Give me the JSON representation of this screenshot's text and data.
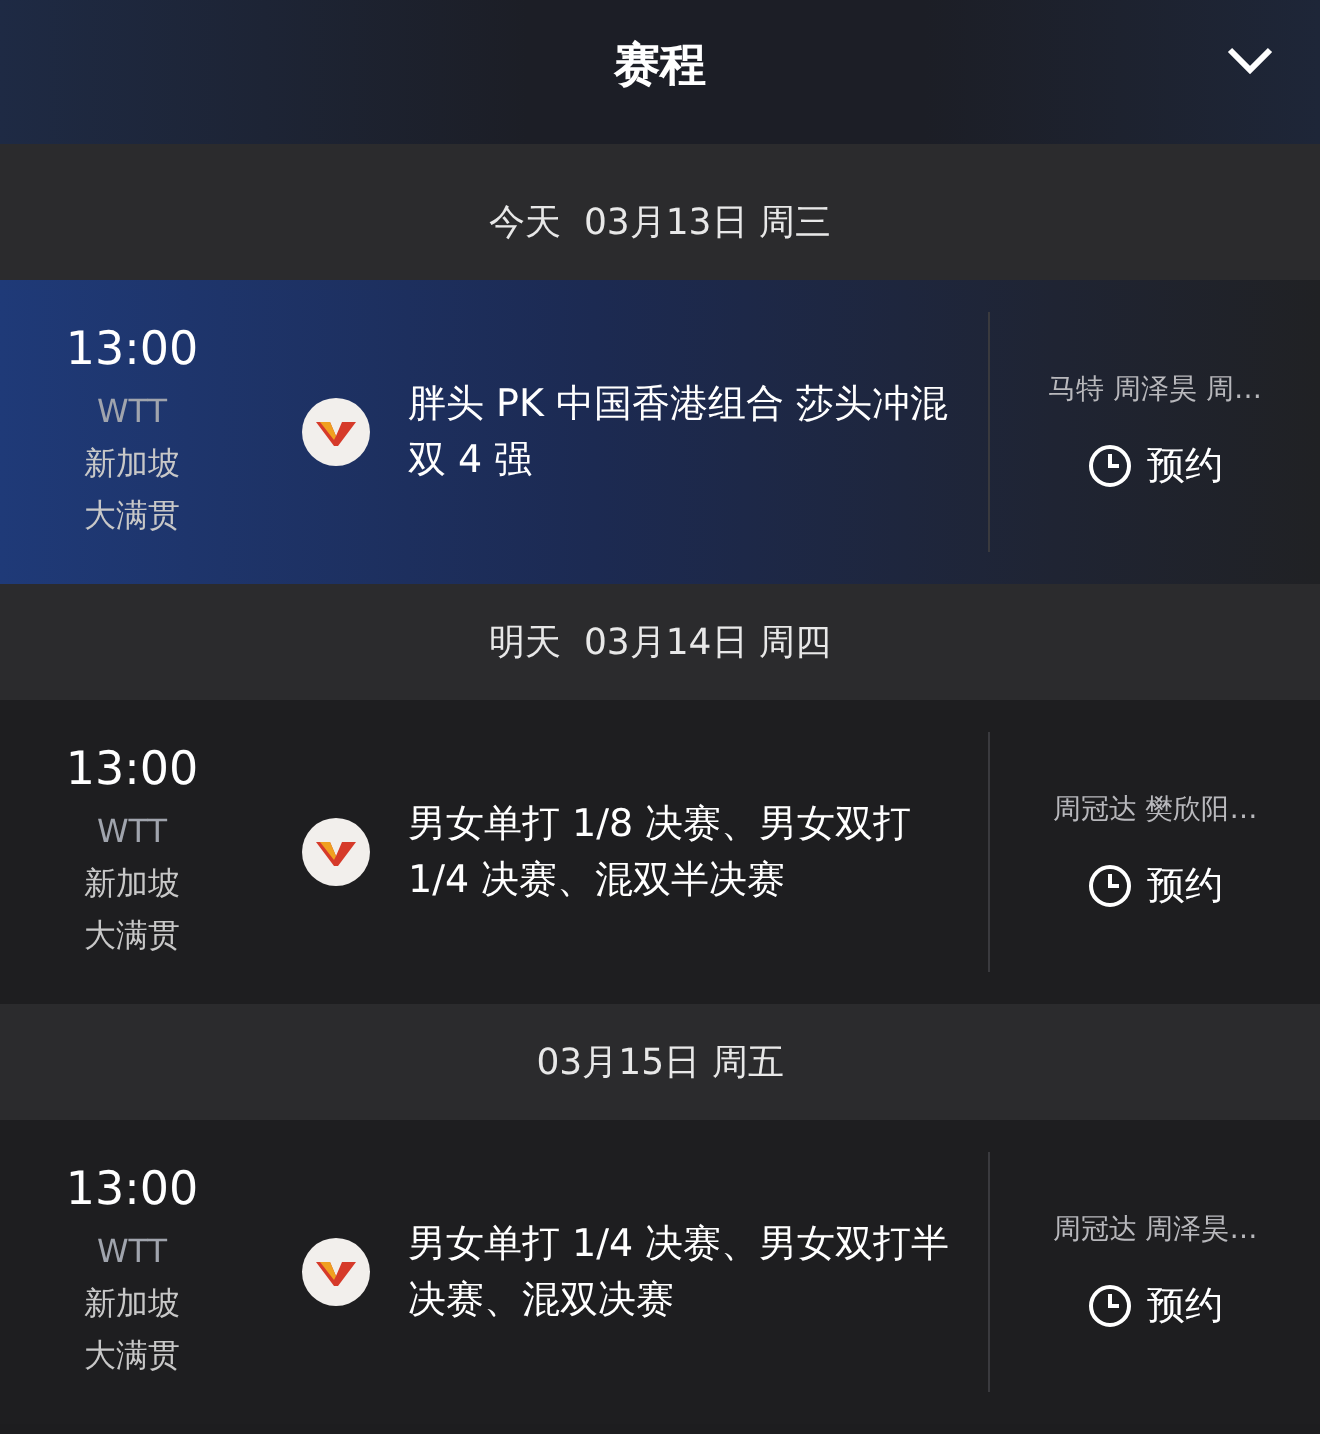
{
  "header": {
    "title": "赛程"
  },
  "days": [
    {
      "date_label": "今天  03月13日 周三",
      "matches": [
        {
          "time": "13:00",
          "event_lines": [
            "WTT",
            "新加坡",
            "大满贯"
          ],
          "title": "胖头 PK 中国香港组合 莎头冲混双 4 强",
          "players": "马特 周泽昊 周…",
          "action": "预约",
          "selected": true
        }
      ]
    },
    {
      "date_label": "明天  03月14日 周四",
      "matches": [
        {
          "time": "13:00",
          "event_lines": [
            "WTT",
            "新加坡",
            "大满贯"
          ],
          "title": "男女单打 1/8 决赛、男女双打 1/4 决赛、混双半决赛",
          "players": "周冠达 樊欣阳…",
          "action": "预约",
          "selected": false
        }
      ]
    },
    {
      "date_label": "03月15日 周五",
      "matches": [
        {
          "time": "13:00",
          "event_lines": [
            "WTT",
            "新加坡",
            "大满贯"
          ],
          "title": "男女单打 1/4 决赛、男女双打半决赛、混双决赛",
          "players": "周冠达 周泽昊…",
          "action": "预约",
          "selected": false
        }
      ]
    }
  ]
}
